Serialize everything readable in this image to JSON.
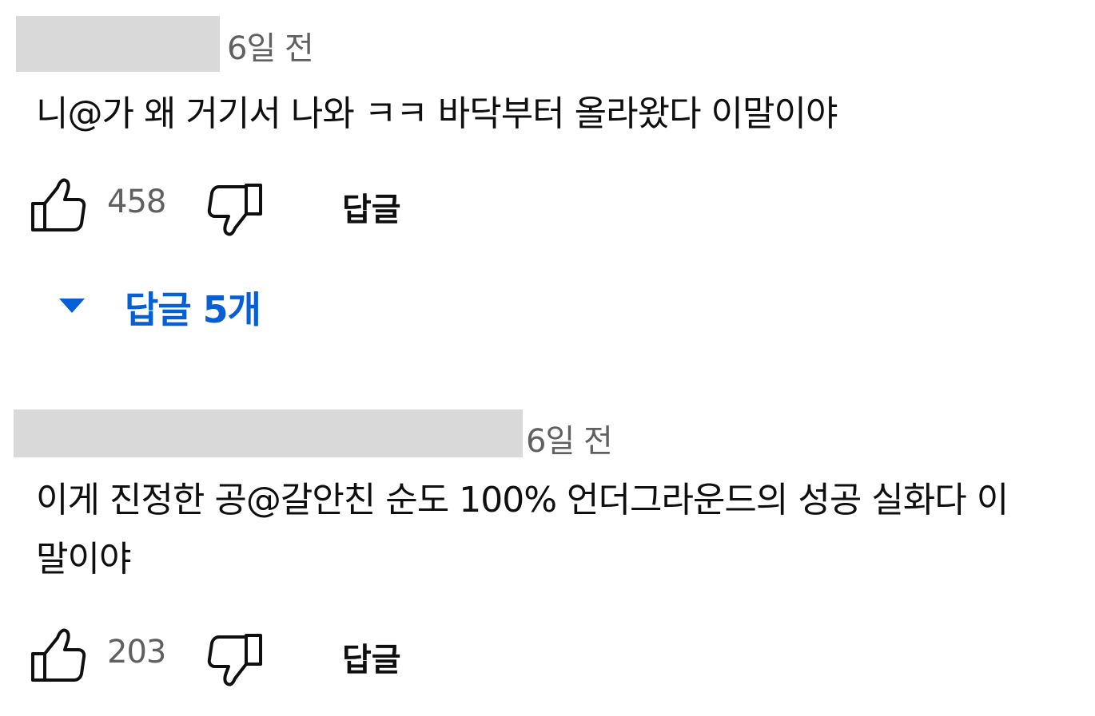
{
  "comments": [
    {
      "time": "6일 전",
      "text": "니@가 왜 거기서 나와 ㅋㅋ 바닥부터 올라왔다 이말이야",
      "like_count": "458",
      "reply_label": "답글",
      "replies_toggle": "답글 5개"
    },
    {
      "time": "6일 전",
      "text": "이게 진정한 공@갈안친 순도 100% 언더그라운드의 성공 실화다 이말이야",
      "like_count": "203",
      "reply_label": "답글"
    }
  ],
  "icons": {
    "like": "thumbs-up-icon",
    "dislike": "thumbs-down-icon",
    "expand": "caret-down-icon"
  },
  "colors": {
    "link_blue": "#065fd4",
    "muted_text": "#606060",
    "redaction_gray": "#d9d9d9"
  }
}
